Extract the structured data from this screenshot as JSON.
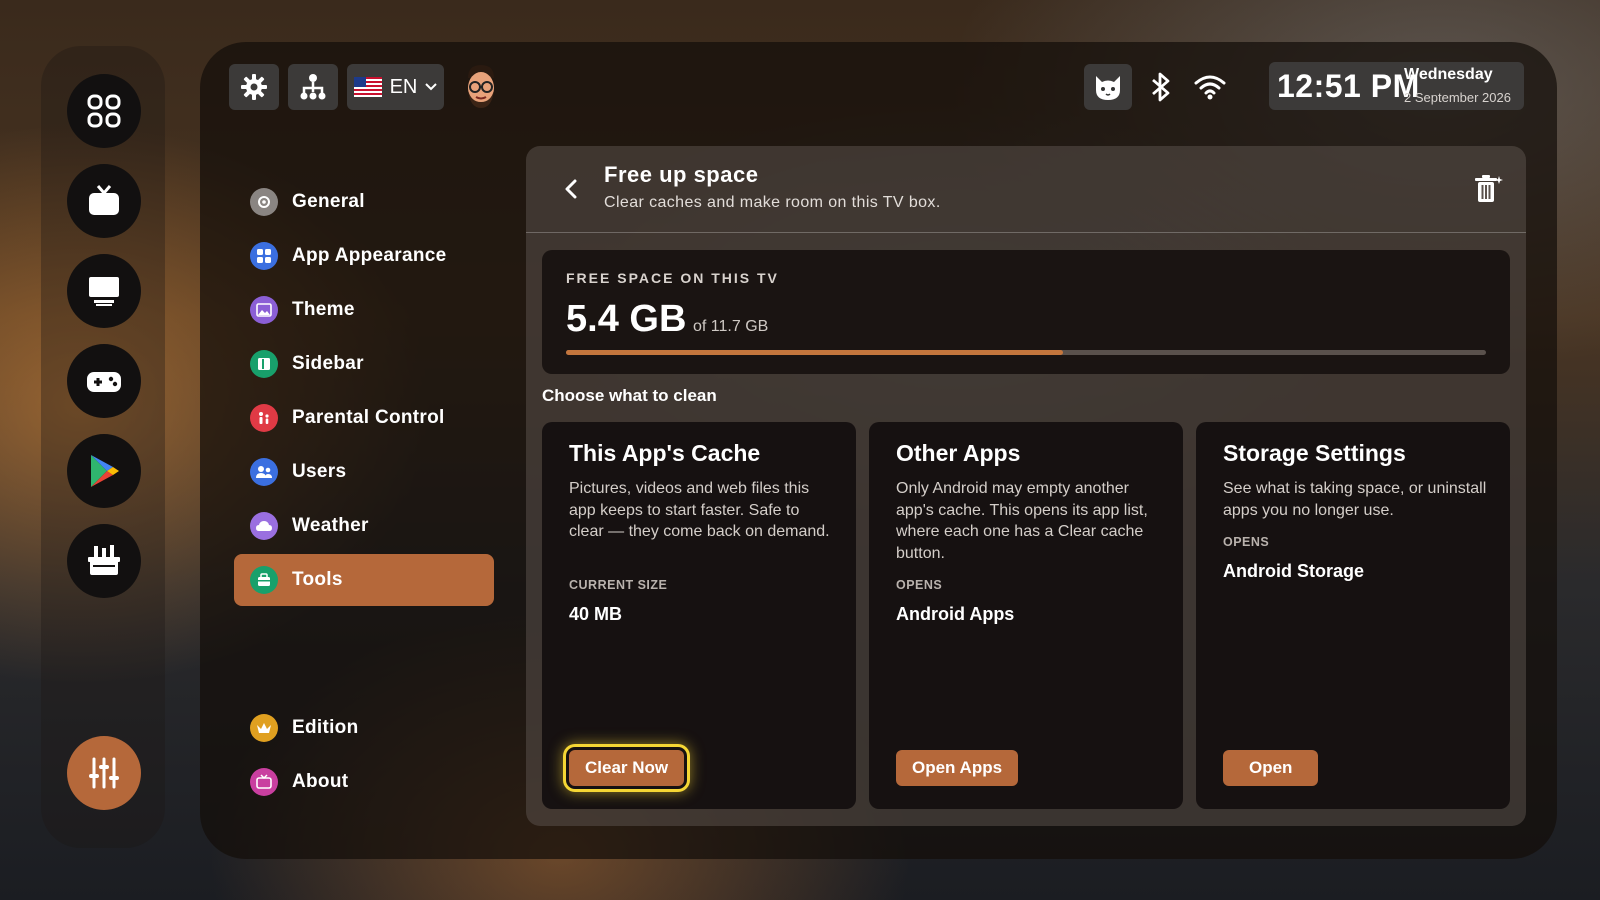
{
  "topbar": {
    "language": "EN",
    "clock": {
      "time": "12:51 PM",
      "day": "Wednesday",
      "date": "2 September 2026"
    }
  },
  "nav": {
    "items": [
      {
        "label": "General",
        "icon": "gear-icon",
        "color": "#8a8582"
      },
      {
        "label": "App Appearance",
        "icon": "apps-icon",
        "color": "#3b6fe0"
      },
      {
        "label": "Theme",
        "icon": "image-icon",
        "color": "#8b5fd6"
      },
      {
        "label": "Sidebar",
        "icon": "sidebar-icon",
        "color": "#18a06b"
      },
      {
        "label": "Parental Control",
        "icon": "parental-icon",
        "color": "#e03a45"
      },
      {
        "label": "Users",
        "icon": "users-icon",
        "color": "#3b6fe0"
      },
      {
        "label": "Weather",
        "icon": "weather-icon",
        "color": "#9a6fe0"
      },
      {
        "label": "Tools",
        "icon": "tools-icon",
        "color": "#18a06b"
      },
      {
        "label": "Edition",
        "icon": "crown-icon",
        "color": "#e0a020"
      },
      {
        "label": "About",
        "icon": "tv-icon",
        "color": "#c93fa0"
      }
    ],
    "active": "Tools"
  },
  "header": {
    "title": "Free up space",
    "subtitle": "Clear caches and make room on this TV box."
  },
  "storage": {
    "label": "FREE SPACE ON THIS TV",
    "free": "5.4 GB",
    "total": "of 11.7 GB",
    "used_fraction": 0.54
  },
  "choose_label": "Choose what to clean",
  "cards": [
    {
      "title": "This App's Cache",
      "description": "Pictures, videos and web files this app keeps to start faster. Safe to clear — they come back on demand.",
      "key": "CURRENT SIZE",
      "value": "40 MB",
      "button": "Clear Now"
    },
    {
      "title": "Other Apps",
      "description": "Only Android may empty another app's cache. This opens its app list, where each one has a Clear cache button.",
      "key": "OPENS",
      "value": "Android Apps",
      "button": "Open Apps"
    },
    {
      "title": "Storage Settings",
      "description": "See what is taking space, or uninstall apps you no longer use.",
      "key": "OPENS",
      "value": "Android Storage",
      "button": "Open"
    }
  ],
  "colors": {
    "accent": "#b5683a",
    "focus": "#f5d634"
  }
}
